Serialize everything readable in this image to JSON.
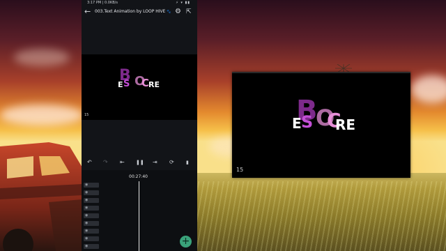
{
  "status_bar": {
    "time": "3:17 PM | 0.0KB/s",
    "icons": "⚡ ▾ ▮▮"
  },
  "project": {
    "title": "003.Text Animation by LOOP HIVE",
    "title_icon": "🐾"
  },
  "preview": {
    "frame_number": "15",
    "letters": {
      "e": "E",
      "s": "S",
      "b": "B",
      "o": "O",
      "c": "C",
      "re": "RE"
    }
  },
  "popup_preview": {
    "frame_number": "15",
    "letters": {
      "e": "E",
      "s": "S",
      "b": "B",
      "o": "O",
      "c": "C",
      "re": "RE"
    }
  },
  "playback": {
    "undo": "↶",
    "redo": "↷",
    "skip_back": "⇤",
    "pause": "❚❚",
    "skip_forward": "⇥",
    "loop": "⟳",
    "bookmark": "▮"
  },
  "timeline": {
    "timecode": "00:27:40",
    "layer_count": 9
  },
  "fab": {
    "label": "+"
  },
  "colors": {
    "magenta": "#c34fd6",
    "pink": "#e78fd8",
    "accent_green": "#3aa27a"
  }
}
